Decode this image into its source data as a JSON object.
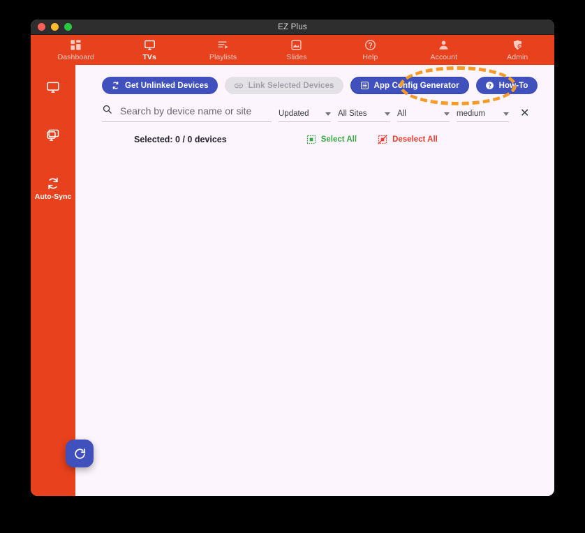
{
  "window": {
    "title": "EZ Plus",
    "traffic_lights": [
      "close-red",
      "minimize-yellow",
      "maximize-green"
    ]
  },
  "topnav": {
    "items": [
      {
        "label": "Dashboard",
        "icon": "dashboard-grid-icon",
        "active": false
      },
      {
        "label": "TVs",
        "icon": "monitor-icon",
        "active": true
      },
      {
        "label": "Playlists",
        "icon": "playlist-icon",
        "active": false
      },
      {
        "label": "Slides",
        "icon": "image-slide-icon",
        "active": false
      },
      {
        "label": "Help",
        "icon": "question-circle-icon",
        "active": false
      },
      {
        "label": "Account",
        "icon": "person-icon",
        "active": false
      },
      {
        "label": "Admin",
        "icon": "admin-shield-icon",
        "active": false
      }
    ]
  },
  "sidebar": {
    "items": [
      {
        "label": "",
        "icon": "monitor-outline-icon"
      },
      {
        "label": "",
        "icon": "monitor-stacked-icon"
      },
      {
        "label": "Auto-Sync",
        "icon": "sync-refresh-icon"
      }
    ],
    "fab": {
      "icon": "refresh-reload-icon",
      "label": ""
    }
  },
  "toolbar": {
    "get_unlinked_label": "Get Unlinked Devices",
    "link_selected_label": "Link Selected Devices",
    "app_config_label": "App Config Generator",
    "how_to_label": "How-To",
    "link_selected_disabled": true,
    "highlighted_button": "App Config Generator"
  },
  "filters": {
    "search_placeholder": "Search by device name or site",
    "search_value": "",
    "dropdowns": [
      {
        "name": "sort",
        "value": "Updated"
      },
      {
        "name": "site",
        "value": "All Sites"
      },
      {
        "name": "status",
        "value": "All"
      },
      {
        "name": "size",
        "value": "medium"
      }
    ],
    "clear_label": "✕"
  },
  "selection": {
    "count_label": "Selected: 0 / 0 devices",
    "select_all_label": "Select All",
    "deselect_all_label": "Deselect All"
  },
  "colors": {
    "brand_orange": "#e8411d",
    "accent_blue": "#4050bd",
    "highlight_orange": "#f79b28",
    "green": "#3aa845",
    "red": "#ef3b2f",
    "content_bg": "#fdf5fd",
    "titlebar_bg": "#2e2e2e"
  }
}
